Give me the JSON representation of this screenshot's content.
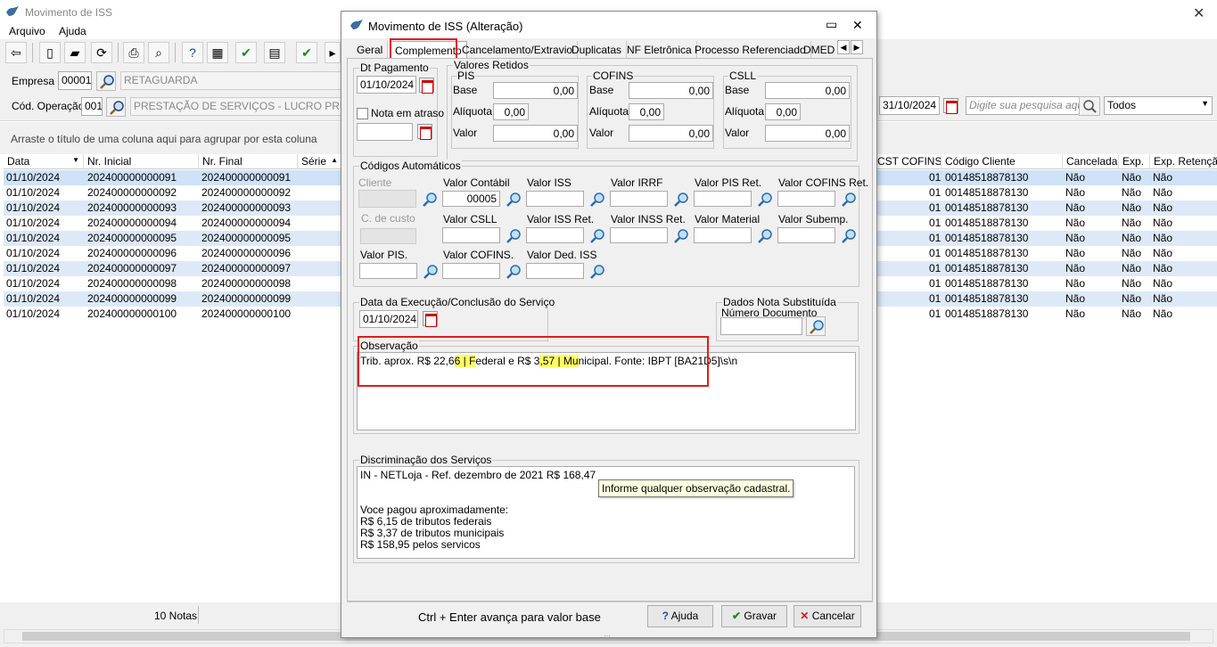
{
  "main": {
    "title": "Movimento de ISS",
    "menu": [
      "Arquivo",
      "Ajuda"
    ],
    "empresa_label": "Empresa",
    "empresa_code": "00001",
    "empresa_name": "RETAGUARDA",
    "cod_operacao_label": "Cód. Operação",
    "cod_operacao_code": "001",
    "cod_operacao_name": "PRESTAÇÃO DE SERVIÇOS - LUCRO PRESUM",
    "date_to": "31/10/2024",
    "search_placeholder": "Digite sua pesquisa aqui...",
    "filter_select": "Todos",
    "group_hint": "Arraste o título de uma coluna aqui para agrupar por esta coluna",
    "grid_left_headers": [
      "Data",
      "Nr. Inicial",
      "Nr. Final",
      "Série"
    ],
    "grid_right_headers": [
      "CST COFINS",
      "Código Cliente",
      "Cancelada",
      "Exp.",
      "Exp. Retenção"
    ],
    "rows": [
      {
        "data": "01/10/2024",
        "ini": "202400000000091",
        "fim": "202400000000091",
        "cst": "01",
        "cli": "00148518878130",
        "canc": "Não",
        "exp": "Não",
        "expr": "Não"
      },
      {
        "data": "01/10/2024",
        "ini": "202400000000092",
        "fim": "202400000000092",
        "cst": "01",
        "cli": "00148518878130",
        "canc": "Não",
        "exp": "Não",
        "expr": "Não"
      },
      {
        "data": "01/10/2024",
        "ini": "202400000000093",
        "fim": "202400000000093",
        "cst": "01",
        "cli": "00148518878130",
        "canc": "Não",
        "exp": "Não",
        "expr": "Não"
      },
      {
        "data": "01/10/2024",
        "ini": "202400000000094",
        "fim": "202400000000094",
        "cst": "01",
        "cli": "00148518878130",
        "canc": "Não",
        "exp": "Não",
        "expr": "Não"
      },
      {
        "data": "01/10/2024",
        "ini": "202400000000095",
        "fim": "202400000000095",
        "cst": "01",
        "cli": "00148518878130",
        "canc": "Não",
        "exp": "Não",
        "expr": "Não"
      },
      {
        "data": "01/10/2024",
        "ini": "202400000000096",
        "fim": "202400000000096",
        "cst": "01",
        "cli": "00148518878130",
        "canc": "Não",
        "exp": "Não",
        "expr": "Não"
      },
      {
        "data": "01/10/2024",
        "ini": "202400000000097",
        "fim": "202400000000097",
        "cst": "01",
        "cli": "00148518878130",
        "canc": "Não",
        "exp": "Não",
        "expr": "Não"
      },
      {
        "data": "01/10/2024",
        "ini": "202400000000098",
        "fim": "202400000000098",
        "cst": "01",
        "cli": "00148518878130",
        "canc": "Não",
        "exp": "Não",
        "expr": "Não"
      },
      {
        "data": "01/10/2024",
        "ini": "202400000000099",
        "fim": "202400000000099",
        "cst": "01",
        "cli": "00148518878130",
        "canc": "Não",
        "exp": "Não",
        "expr": "Não"
      },
      {
        "data": "01/10/2024",
        "ini": "202400000000100",
        "fim": "202400000000100",
        "cst": "01",
        "cli": "00148518878130",
        "canc": "Não",
        "exp": "Não",
        "expr": "Não"
      }
    ],
    "footer_count": "10 Notas"
  },
  "dialog": {
    "title": "Movimento de ISS (Alteração)",
    "tabs": [
      "Geral",
      "Complemento",
      "Cancelamento/Extravio",
      "Duplicatas",
      "NF Eletrônica",
      "Processo Referenciado",
      "DMED"
    ],
    "dt_pagamento_legend": "Dt Pagamento",
    "dt_pagamento": "01/10/2024",
    "nota_atraso_label": "Nota em atraso",
    "valores_retidos_legend": "Valores Retidos",
    "pis_legend": "PIS",
    "cofins_legend": "COFINS",
    "csll_legend": "CSLL",
    "base_label": "Base",
    "aliquota_label": "Alíquota",
    "valor_label": "Valor",
    "zero": "0,00",
    "codigos_legend": "Códigos Automáticos",
    "cliente_label": "Cliente",
    "c_custo_label": "C. de custo",
    "valor_contabil_label": "Valor Contábil",
    "valor_contabil": "00005",
    "valor_iss_label": "Valor ISS",
    "valor_irrf_label": "Valor IRRF",
    "valor_pis_ret_label": "Valor PIS Ret.",
    "valor_cofins_ret_label": "Valor COFINS Ret.",
    "valor_csll_label": "Valor CSLL",
    "valor_iss_ret_label": "Valor ISS Ret.",
    "valor_inss_ret_label": "Valor INSS Ret.",
    "valor_material_label": "Valor Material",
    "valor_subemp_label": "Valor Subemp.",
    "valor_pis_label": "Valor PIS.",
    "valor_cofins_label": "Valor COFINS.",
    "valor_ded_iss_label": "Valor Ded. ISS",
    "execucao_legend": "Data da Execução/Conclusão do Serviço",
    "execucao_date": "01/10/2024",
    "nota_subst_legend": "Dados Nota Substituída",
    "numero_documento_label": "Número Documento",
    "observacao_legend": "Observação",
    "obs_text_1": "Trib. aprox. R$ 22,6",
    "obs_hl_1": "6 | F",
    "obs_text_2": "ederal e R$ 3",
    "obs_hl_2": ",57 | Mu",
    "obs_text_3": "nicipal. Fonte: IBPT [BA21D5]\\s\\n",
    "discriminacao_legend": "Discriminação dos Serviços",
    "discriminacao_text": "IN - NETLoja - Ref. dezembro de 2021 R$ 168,47\n\n\nVoce pagou aproximadamente:\nR$ 6,15 de tributos federais\nR$ 3,37 de tributos municipais\nR$ 158,95 pelos servicos",
    "tooltip": "Informe qualquer observação cadastral.",
    "hint": "Ctrl + Enter avança para valor base",
    "ajuda_label": "Ajuda",
    "gravar_label": "Gravar",
    "cancelar_label": "Cancelar"
  },
  "colors": {
    "highlight": "#ffff66",
    "annotation_red": "#e31b1b",
    "row_alt": "#dde9f7"
  }
}
